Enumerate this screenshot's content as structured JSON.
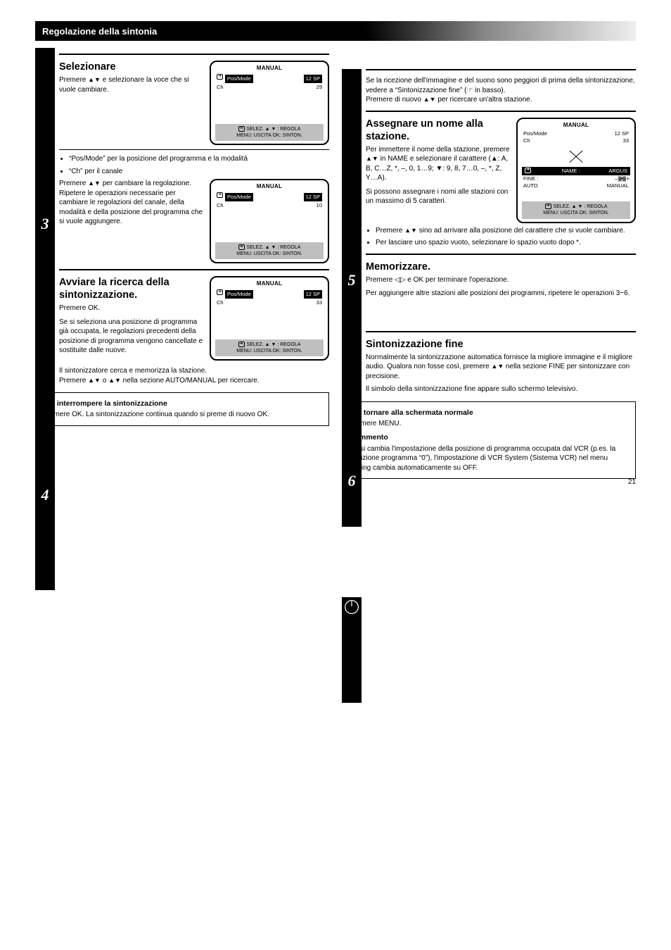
{
  "header": {
    "title": "Regolazione della sintonia"
  },
  "left": {
    "step3": {
      "title": "Selezionare",
      "body_before": "Premere ",
      "body_after": " e selezionare la voce che si vuole cambiare.",
      "list": [
        "“Pos/Mode” per la posizione del programma e la modalità",
        "“Ch” per il canale"
      ],
      "para_intro_before": "Premere ",
      "para_intro_after": " per cambiare la regolazione.",
      "para_text": "Ripetere le operazioni necessarie per cambiare le regolazioni del canale, della modalità e della posizione del programma che si vuole aggiungere."
    },
    "step4": {
      "title": "Avviare la ricerca della sintonizzazione.",
      "body": "Premere OK.",
      "footer": "Se si seleziona una posizione di programma già occupata, le regolazioni precedenti della posizione di programma vengono cancellate e sostituite dalle nuove.",
      "result_intro": "Il sintonizzatore cerca e memorizza la stazione.",
      "result_body_before": "Premere ",
      "result_body_mid": " o ",
      "result_body_after": " nella sezione AUTO/MANUAL per ricercare."
    },
    "osd_a": {
      "head": "MANUAL",
      "row_sel_l": "Pos/Mode",
      "row_sel_r": "12 SP",
      "row_l": "Ch",
      "row_r": "29",
      "footer1": "SELEZ. ▲ ▼ : REGOLA",
      "footer2": "MENU: USCITA OK: SINTON."
    },
    "osd_b": {
      "head": "MANUAL",
      "row_sel_l": "Pos/Mode",
      "row_sel_r": "12 SP",
      "row_l": "Ch",
      "row_r": "10",
      "footer1": "SELEZ. ▲ ▼ : REGOLA",
      "footer2": "MENU: USCITA OK: SINTON."
    },
    "osd_c": {
      "head": "MANUAL",
      "row_sel_l": "Pos/Mode",
      "row_sel_r": "12 SP",
      "row_l": "Ch",
      "row_r": "33",
      "footer1": "SELEZ. ▲ ▼ : REGOLA",
      "footer2": "MENU: USCITA OK: SINTON."
    },
    "note": {
      "title": "Per interrompere la sintonizzazione",
      "body": "Premere OK. La sintonizzazione continua quando si preme di nuovo OK."
    }
  },
  "right": {
    "intro": {
      "line1_prefix": "Se la ricezione dell'immagine e del suono sono peggiori di prima della sintonizzazione, vedere a “Sintonizzazione fine” (",
      "line1_suffix": " in basso).",
      "line2_before": "Premere di nuovo ",
      "line2_after": " per ricercare un'altra stazione."
    },
    "step5": {
      "title": "Assegnare un nome alla stazione.",
      "body_p1_before": "Per immettere il nome della stazione, premere ",
      "body_p1_after": " in NAME e selezionare il carattere (▲: A, B, C…Z, *, –, 0, 1…9; ▼: 9, 8, 7…0, –, *, Z, Y…A).",
      "body_p2": "Si possono assegnare i nomi alle stazioni con un massimo di 5 caratteri.",
      "list": [
        {
          "before": "Premere ",
          "after": " sino ad arrivare alla posizione del carattere che si vuole cambiare."
        },
        {
          "text": "Per lasciare uno spazio vuoto, selezionare lo spazio vuoto dopo *."
        }
      ]
    },
    "step6": {
      "title": "Memorizzare.",
      "body_before": "Premere ",
      "body_after": " e OK per terminare l'operazione.",
      "footer": "Per aggiungere altre stazioni alle posizioni dei programmi, ripetere le operazioni 3~6."
    },
    "osd_d": {
      "head": "MANUAL",
      "row1_l": "Pos/Mode",
      "row1_r": "12 SP",
      "row2_l": "Ch",
      "row2_r": "33",
      "name_label": "NAME :",
      "name_value": "ARGUS",
      "fine_l": "FINE :",
      "fine_tick": "|||||||||||||",
      "auto_l": "AUTO",
      "auto_r": "MANUAL",
      "footer1": "SELEZ. ▲ ▼ : REGOLA",
      "footer2": "MENU: USCITA OK: SINTON."
    },
    "fine_section": {
      "title": "Sintonizzazione fine",
      "body_before": "Normalmente la sintonizzazione automatica fornisce la migliore immagine e il migliore audio. Qualora non fosse così, premere ",
      "body_after": " nella sezione FINE per sintonizzare con precisione.",
      "body2": "Il simbolo della sintonizzazione fine appare sullo schermo televisivo."
    },
    "note": {
      "title": "Per tornare alla schermata normale",
      "body": "Premere MENU.",
      "title2": "Commento",
      "body2": "Se si cambia l'impostazione della posizione di programma occupata dal VCR (p.es. la posizione programma “0”), l'impostazione di VCR System (Sistema VCR) nel menu Tuning cambia automaticamente su OFF."
    }
  },
  "page": "21"
}
